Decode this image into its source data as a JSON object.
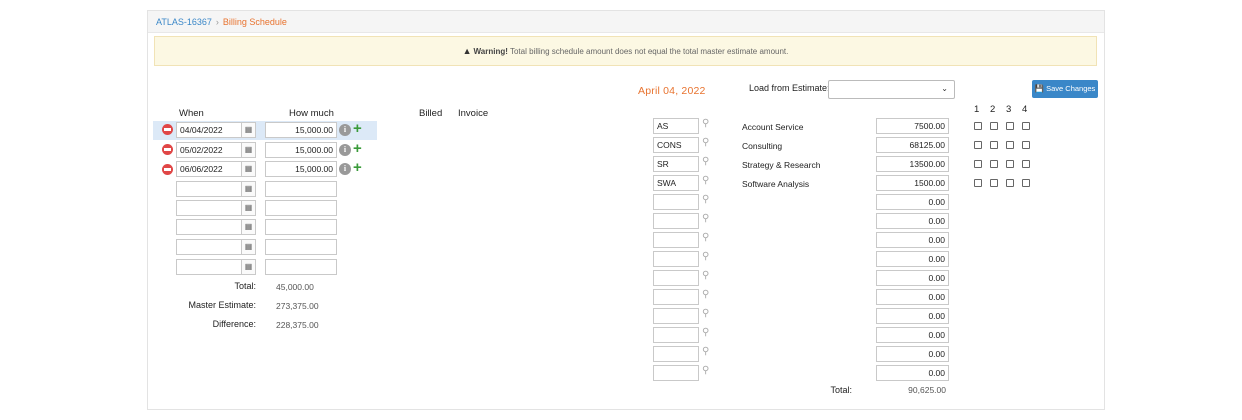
{
  "breadcrumb": {
    "project": "ATLAS-16367",
    "separator": "›",
    "page": "Billing Schedule"
  },
  "warning": {
    "bold": "Warning!",
    "text": " Total billing schedule amount does not equal the total master estimate amount."
  },
  "toolbar": {
    "date": "April 04, 2022",
    "load_label": "Load from Estimate:",
    "load_value": "",
    "save_label": "Save Changes"
  },
  "schedule": {
    "headers": {
      "when": "When",
      "how_much": "How much",
      "billed": "Billed",
      "invoice": "Invoice"
    },
    "rows": [
      {
        "date": "04/04/2022",
        "amount": "15,000.00"
      },
      {
        "date": "05/02/2022",
        "amount": "15,000.00"
      },
      {
        "date": "06/06/2022",
        "amount": "15,000.00"
      },
      {
        "date": "",
        "amount": ""
      },
      {
        "date": "",
        "amount": ""
      },
      {
        "date": "",
        "amount": ""
      },
      {
        "date": "",
        "amount": ""
      },
      {
        "date": "",
        "amount": ""
      }
    ],
    "summary": {
      "total_label": "Total:",
      "total_value": "45,000.00",
      "master_label": "Master Estimate:",
      "master_value": "273,375.00",
      "diff_label": "Difference:",
      "diff_value": "228,375.00"
    }
  },
  "estimate": {
    "column_numbers": [
      "1",
      "2",
      "3",
      "4"
    ],
    "rows": [
      {
        "code": "AS",
        "name": "Account Service",
        "amount": "7500.00",
        "checks": [
          false,
          false,
          false,
          false
        ]
      },
      {
        "code": "CONS",
        "name": "Consulting",
        "amount": "68125.00",
        "checks": [
          false,
          false,
          false,
          false
        ]
      },
      {
        "code": "SR",
        "name": "Strategy & Research",
        "amount": "13500.00",
        "checks": [
          false,
          false,
          false,
          false
        ]
      },
      {
        "code": "SWA",
        "name": "Software Analysis",
        "amount": "1500.00",
        "checks": [
          false,
          false,
          false,
          false
        ]
      },
      {
        "code": "",
        "name": "",
        "amount": "0.00"
      },
      {
        "code": "",
        "name": "",
        "amount": "0.00"
      },
      {
        "code": "",
        "name": "",
        "amount": "0.00"
      },
      {
        "code": "",
        "name": "",
        "amount": "0.00"
      },
      {
        "code": "",
        "name": "",
        "amount": "0.00"
      },
      {
        "code": "",
        "name": "",
        "amount": "0.00"
      },
      {
        "code": "",
        "name": "",
        "amount": "0.00"
      },
      {
        "code": "",
        "name": "",
        "amount": "0.00"
      },
      {
        "code": "",
        "name": "",
        "amount": "0.00"
      },
      {
        "code": "",
        "name": "",
        "amount": "0.00"
      }
    ],
    "total_label": "Total:",
    "total_value": "90,625.00"
  },
  "icons": {
    "remove": "minus-circle-icon",
    "calendar": "calendar-icon",
    "info": "info-icon",
    "add": "plus-icon",
    "search": "search-icon",
    "save": "save-icon",
    "warning": "warning-icon"
  },
  "colors": {
    "accent": "#3a87c8",
    "orange": "#e8732f",
    "remove": "#e04646",
    "add": "#3a9b3a",
    "warning_bg": "#fcf8e3"
  }
}
